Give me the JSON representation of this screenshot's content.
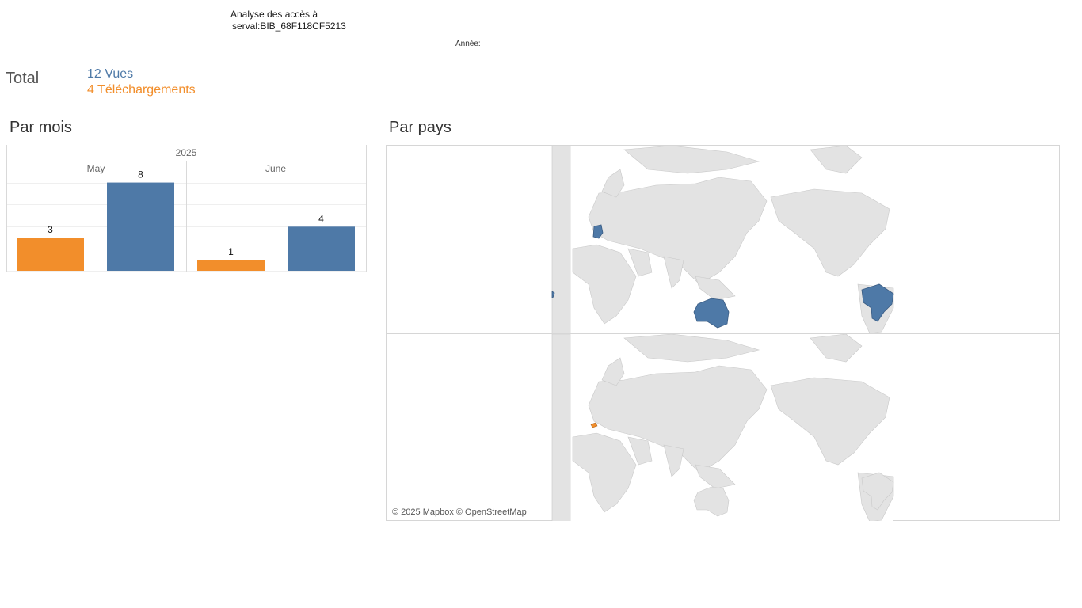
{
  "header": {
    "title_line1": "Analyse des accès à",
    "title_line2": "serval:BIB_68F118CF5213",
    "year_label": "Année:"
  },
  "totals": {
    "label": "Total",
    "views": "12 Vues",
    "downloads": "4 Téléchargements"
  },
  "sections": {
    "by_month": "Par mois",
    "by_country": "Par pays"
  },
  "colors": {
    "views": "#4e79a7",
    "downloads": "#f28e2b",
    "land": "#e3e3e3",
    "land_border": "#c9c9c9"
  },
  "chart_data": {
    "type": "bar",
    "year": "2025",
    "categories": [
      "May",
      "June"
    ],
    "series": [
      {
        "key": "downloads",
        "values": [
          3,
          1
        ]
      },
      {
        "key": "views",
        "values": [
          8,
          4
        ]
      }
    ],
    "ylim": [
      0,
      8.4
    ],
    "grid": true
  },
  "map": {
    "attribution": "© 2025 Mapbox © OpenStreetMap",
    "views_countries": [
      "Germany",
      "Australia",
      "Brazil",
      "Cabo Verde"
    ],
    "downloads_countries": [
      "Switzerland"
    ]
  }
}
